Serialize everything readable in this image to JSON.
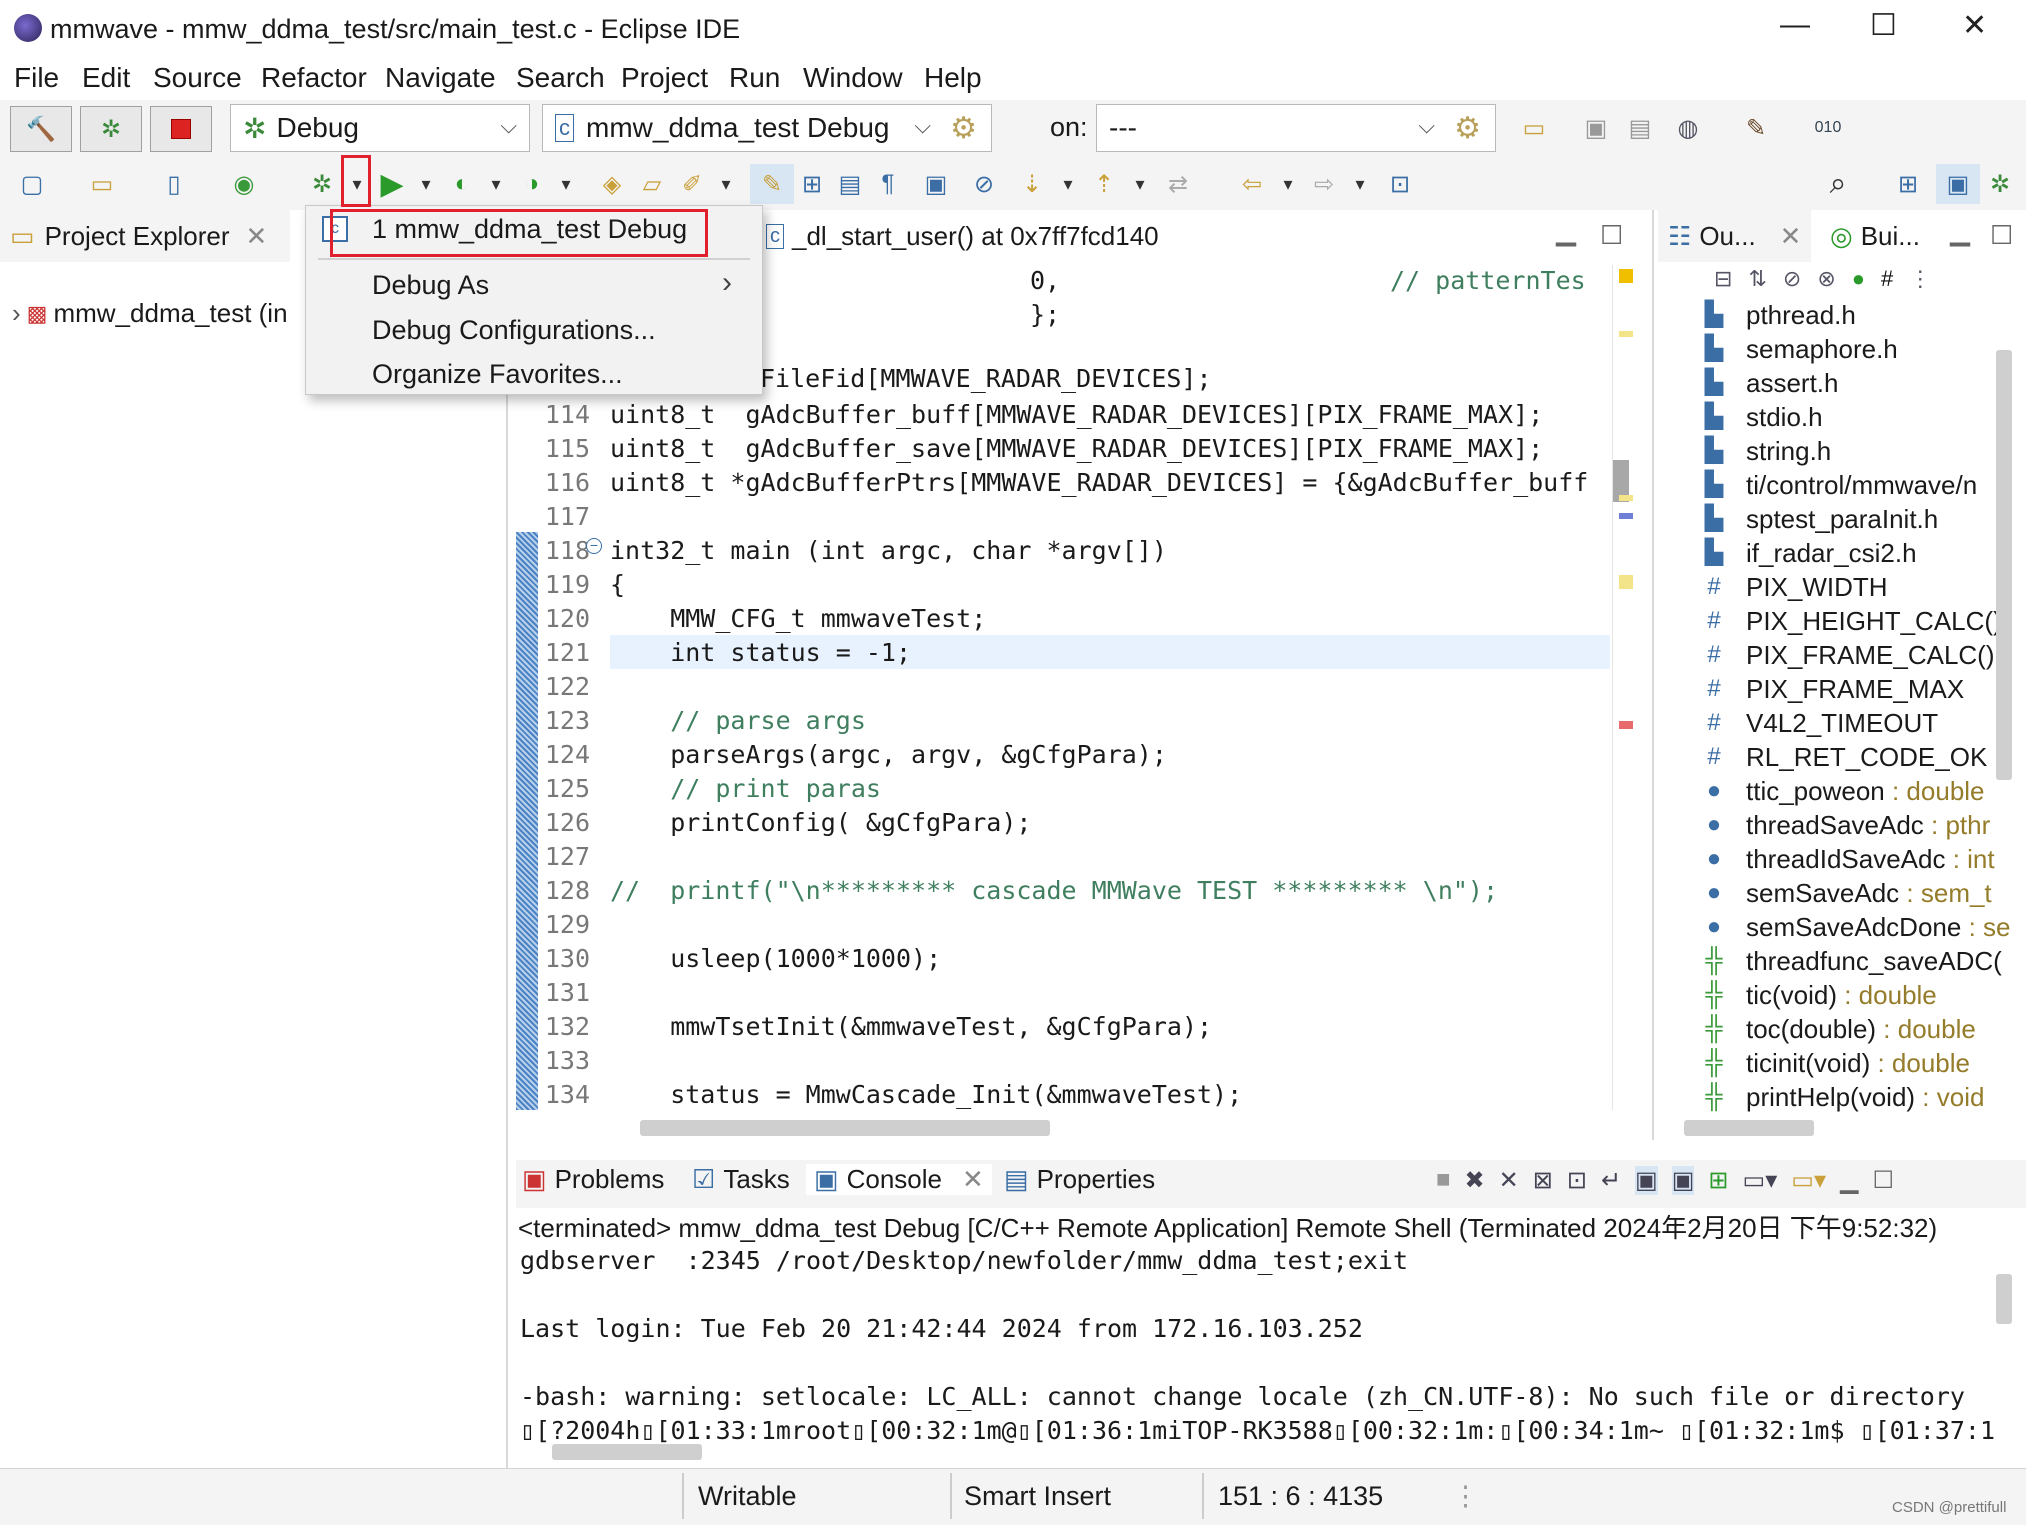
{
  "window": {
    "title": "mmwave - mmw_ddma_test/src/main_test.c - Eclipse IDE",
    "minimize": "—",
    "maximize": "☐",
    "close": "✕"
  },
  "menu": [
    "File",
    "Edit",
    "Source",
    "Refactor",
    "Navigate",
    "Search",
    "Project",
    "Run",
    "Window",
    "Help"
  ],
  "toolbar": {
    "launch_mode": "Debug",
    "launch_config": "mmw_ddma_test Debug",
    "on_label": "on:",
    "target": "---"
  },
  "debug_menu": {
    "items": [
      "1 mmw_ddma_test Debug",
      "Debug As",
      "Debug Configurations...",
      "Organize Favorites..."
    ],
    "submenu_arrow": "›"
  },
  "project_explorer": {
    "tab": "Project Explorer",
    "tree_item": "mmw_ddma_test (in"
  },
  "editor": {
    "tab": "_dl_start_user() at 0x7ff7fcd140",
    "top_lines": [
      {
        "code": "0,",
        "comment": "// patternTes"
      },
      {
        "code": "};"
      }
    ],
    "partial_line": "FileFid[MMWAVE_RADAR_DEVICES];",
    "lines": [
      {
        "n": "114",
        "code": "uint8_t  gAdcBuffer_buff[MMWAVE_RADAR_DEVICES][PIX_FRAME_MAX];"
      },
      {
        "n": "115",
        "code": "uint8_t  gAdcBuffer_save[MMWAVE_RADAR_DEVICES][PIX_FRAME_MAX];"
      },
      {
        "n": "116",
        "code": "uint8_t *gAdcBufferPtrs[MMWAVE_RADAR_DEVICES] = {&gAdcBuffer_buff"
      },
      {
        "n": "117",
        "code": ""
      },
      {
        "n": "118",
        "code": "int32_t main (int argc, char *argv[])"
      },
      {
        "n": "119",
        "code": "{"
      },
      {
        "n": "120",
        "code": "    MMW_CFG_t mmwaveTest;"
      },
      {
        "n": "121",
        "code": "    int status = -1;"
      },
      {
        "n": "122",
        "code": ""
      },
      {
        "n": "123",
        "code": "    // parse args"
      },
      {
        "n": "124",
        "code": "    parseArgs(argc, argv, &gCfgPara);"
      },
      {
        "n": "125",
        "code": "    // print paras"
      },
      {
        "n": "126",
        "code": "    printConfig( &gCfgPara);"
      },
      {
        "n": "127",
        "code": ""
      },
      {
        "n": "128",
        "code": "//  printf(\"\\n********* cascade MMWave TEST ********* \\n\");"
      },
      {
        "n": "129",
        "code": ""
      },
      {
        "n": "130",
        "code": "    usleep(1000*1000);"
      },
      {
        "n": "131",
        "code": ""
      },
      {
        "n": "132",
        "code": "    mmwTsetInit(&mmwaveTest, &gCfgPara);"
      },
      {
        "n": "133",
        "code": ""
      },
      {
        "n": "134",
        "code": "    status = MmwCascade_Init(&mmwaveTest);"
      }
    ]
  },
  "outline": {
    "tab1": "Ou...",
    "tab2": "Bui...",
    "items": [
      {
        "icon": "include",
        "name": "pthread.h",
        "type": ""
      },
      {
        "icon": "include",
        "name": "semaphore.h",
        "type": ""
      },
      {
        "icon": "include",
        "name": "assert.h",
        "type": ""
      },
      {
        "icon": "include",
        "name": "stdio.h",
        "type": ""
      },
      {
        "icon": "include",
        "name": "string.h",
        "type": ""
      },
      {
        "icon": "include",
        "name": "ti/control/mmwave/n",
        "type": ""
      },
      {
        "icon": "include",
        "name": "sptest_paraInit.h",
        "type": ""
      },
      {
        "icon": "include",
        "name": "if_radar_csi2.h",
        "type": ""
      },
      {
        "icon": "macro",
        "name": "PIX_WIDTH",
        "type": ""
      },
      {
        "icon": "macro",
        "name": "PIX_HEIGHT_CALC()",
        "type": ""
      },
      {
        "icon": "macro",
        "name": "PIX_FRAME_CALC()",
        "type": ""
      },
      {
        "icon": "macro",
        "name": "PIX_FRAME_MAX",
        "type": ""
      },
      {
        "icon": "macro",
        "name": "V4L2_TIMEOUT",
        "type": ""
      },
      {
        "icon": "macro",
        "name": "RL_RET_CODE_OK",
        "type": ""
      },
      {
        "icon": "var-static",
        "name": "ttic_poweon",
        "type": " : double"
      },
      {
        "icon": "var",
        "name": "threadSaveAdc",
        "type": " : pthr"
      },
      {
        "icon": "var",
        "name": "threadIdSaveAdc",
        "type": " : int"
      },
      {
        "icon": "var",
        "name": "semSaveAdc",
        "type": " : sem_t"
      },
      {
        "icon": "var",
        "name": "semSaveAdcDone",
        "type": " : se"
      },
      {
        "icon": "func",
        "name": "threadfunc_saveADC(",
        "type": ""
      },
      {
        "icon": "func",
        "name": "tic(void)",
        "type": " : double"
      },
      {
        "icon": "func",
        "name": "toc(double)",
        "type": " : double"
      },
      {
        "icon": "func",
        "name": "ticinit(void)",
        "type": " : double"
      },
      {
        "icon": "func",
        "name": "printHelp(void)",
        "type": " : void"
      }
    ]
  },
  "console": {
    "tabs": [
      "Problems",
      "Tasks",
      "Console",
      "Properties"
    ],
    "header": "<terminated> mmw_ddma_test Debug [C/C++ Remote Application] Remote Shell (Terminated 2024年2月20日 下午9:52:32)",
    "lines": [
      "gdbserver  :2345 /root/Desktop/newfolder/mmw_ddma_test;exit",
      "",
      "Last login: Tue Feb 20 21:42:44 2024 from 172.16.103.252",
      "",
      "-bash: warning: setlocale: LC_ALL: cannot change locale (zh_CN.UTF-8): No such file or directory",
      "▯[?2004h▯[01:33:1mroot▯[00:32:1m@▯[01:36:1miTOP-RK3588▯[00:32:1m:▯[00:34:1m~ ▯[01:32:1m$ ▯[01:37:1"
    ]
  },
  "status": {
    "mode": "Writable",
    "insert": "Smart Insert",
    "position": "151 : 6 : 4135"
  },
  "watermark": "CSDN @prettifull",
  "colors": {
    "highlight_box": "#e0202c",
    "keyword": "#7f0055",
    "comment": "#3f7f5f",
    "accent": "#3a6ea5"
  }
}
